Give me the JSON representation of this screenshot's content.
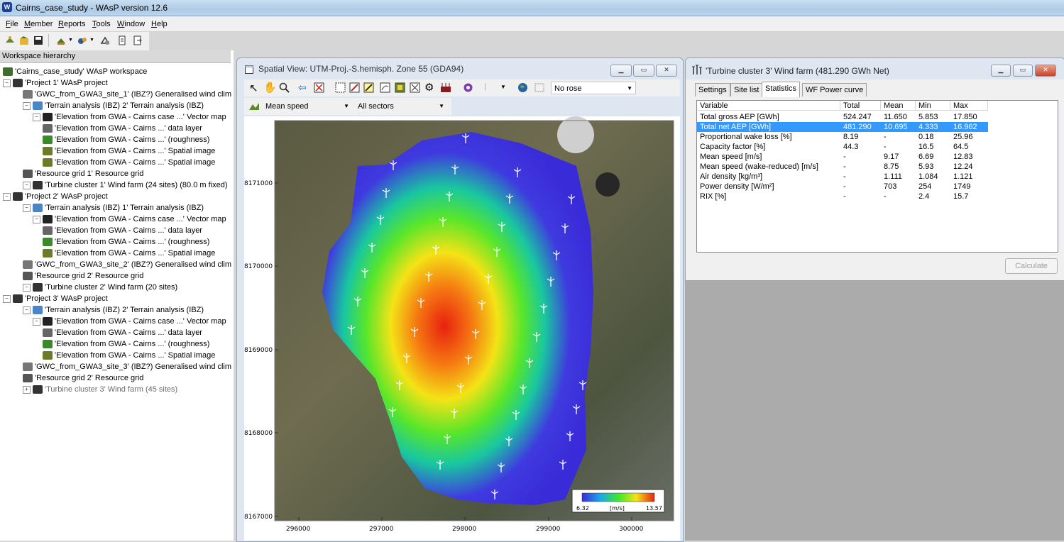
{
  "window": {
    "title": "Cairns_case_study - WAsP version 12.6",
    "app_icon": "W"
  },
  "menu": [
    "File",
    "Member",
    "Reports",
    "Tools",
    "Window",
    "Help"
  ],
  "workspace": {
    "header": "Workspace hierarchy",
    "rows": [
      {
        "label": "'Cairns_case_study' WAsP workspace",
        "icon": "workspace-icon"
      },
      {
        "label": "'Project 1' WAsP project",
        "icon": "project-icon"
      },
      {
        "label": "'GWC_from_GWA3_site_1' (IBZ?) Generalised wind clim",
        "icon": "generalised-wind-climate-icon"
      },
      {
        "label": "'Terrain analysis (IBZ) 2' Terrain analysis (IBZ)",
        "icon": "terrain-analysis-icon"
      },
      {
        "label": "'Elevation from GWA - Cairns case ...' Vector map",
        "icon": "vector-map-icon"
      },
      {
        "label": "'Elevation from GWA - Cairns ...' data layer",
        "icon": "data-layer-icon"
      },
      {
        "label": "'Elevation from GWA - Cairns ...' (roughness)",
        "icon": "roughness-layer-icon"
      },
      {
        "label": "'Elevation from GWA - Cairns ...' Spatial image",
        "icon": "spatial-image-icon"
      },
      {
        "label": "'Elevation from GWA - Cairns ...' Spatial image",
        "icon": "spatial-image-icon"
      },
      {
        "label": "'Resource grid 1' Resource grid",
        "icon": "resource-grid-icon"
      },
      {
        "label": "'Turbine cluster 1' Wind farm (24 sites) (80.0 m fixed)",
        "icon": "wind-farm-icon"
      },
      {
        "label": "'Project 2' WAsP project",
        "icon": "project-icon"
      },
      {
        "label": "'Terrain analysis (IBZ) 1' Terrain analysis (IBZ)",
        "icon": "terrain-analysis-icon"
      },
      {
        "label": "'Elevation from GWA - Cairns case ...' Vector map",
        "icon": "vector-map-icon"
      },
      {
        "label": "'Elevation from GWA - Cairns ...' data layer",
        "icon": "data-layer-icon"
      },
      {
        "label": "'Elevation from GWA - Cairns ...' (roughness)",
        "icon": "roughness-layer-icon"
      },
      {
        "label": "'Elevation from GWA - Cairns ...' Spatial image",
        "icon": "spatial-image-icon"
      },
      {
        "label": "'GWC_from_GWA3_site_2' (IBZ?) Generalised wind clim",
        "icon": "generalised-wind-climate-icon"
      },
      {
        "label": "'Resource grid 2' Resource grid",
        "icon": "resource-grid-icon"
      },
      {
        "label": "'Turbine cluster 2' Wind farm (20 sites)",
        "icon": "wind-farm-icon"
      },
      {
        "label": "'Project 3' WAsP project",
        "icon": "project-icon"
      },
      {
        "label": "'Terrain analysis (IBZ) 2' Terrain analysis (IBZ)",
        "icon": "terrain-analysis-icon"
      },
      {
        "label": "'Elevation from GWA - Cairns case ...' Vector map",
        "icon": "vector-map-icon"
      },
      {
        "label": "'Elevation from GWA - Cairns ...' data layer",
        "icon": "data-layer-icon"
      },
      {
        "label": "'Elevation from GWA - Cairns ...' (roughness)",
        "icon": "roughness-layer-icon"
      },
      {
        "label": "'Elevation from GWA - Cairns ...' Spatial image",
        "icon": "spatial-image-icon"
      },
      {
        "label": "'GWC_from_GWA3_site_3' (IBZ?) Generalised wind clim",
        "icon": "generalised-wind-climate-icon"
      },
      {
        "label": "'Resource grid 2' Resource grid",
        "icon": "resource-grid-icon"
      },
      {
        "label": "'Turbine cluster 3' Wind farm (45 sites)",
        "icon": "wind-farm-icon",
        "greyed": true
      }
    ]
  },
  "spatial_view": {
    "title": "Spatial View: UTM-Proj.-S.hemisph. Zone 55 (GDA94)",
    "rose_select": "No rose",
    "variable_select": "Mean speed",
    "sector_select": "All sectors",
    "legend": {
      "min": "6.32",
      "unit": "[m/s]",
      "max": "13.57"
    },
    "y_ticks": [
      "8171000",
      "8170000",
      "8169000",
      "8168000",
      "8167000"
    ],
    "x_ticks": [
      "296000",
      "297000",
      "298000",
      "299000",
      "300000"
    ]
  },
  "wind_farm": {
    "title": "'Turbine cluster 3' Wind farm (481.290 GWh Net)",
    "tabs": [
      "Settings",
      "Site list",
      "Statistics",
      "WF Power curve"
    ],
    "active_tab": "Statistics",
    "columns": [
      "Variable",
      "Total",
      "Mean",
      "Min",
      "Max"
    ],
    "rows": [
      {
        "variable": "Total gross AEP [GWh]",
        "total": "524.247",
        "mean": "11.650",
        "min": "5.853",
        "max": "17.850"
      },
      {
        "variable": "Total net AEP [GWh]",
        "total": "481.290",
        "mean": "10.695",
        "min": "4.333",
        "max": "16.962",
        "selected": true
      },
      {
        "variable": "Proportional wake loss [%]",
        "total": "8.19",
        "mean": "-",
        "min": "0.18",
        "max": "25.96"
      },
      {
        "variable": "Capacity factor [%]",
        "total": "44.3",
        "mean": "-",
        "min": "16.5",
        "max": "64.5"
      },
      {
        "variable": "Mean speed [m/s]",
        "total": "-",
        "mean": "9.17",
        "min": "6.69",
        "max": "12.83"
      },
      {
        "variable": "Mean speed (wake-reduced) [m/s]",
        "total": "-",
        "mean": "8.75",
        "min": "5.93",
        "max": "12.24"
      },
      {
        "variable": "Air density [kg/m³]",
        "total": "-",
        "mean": "1.111",
        "min": "1.084",
        "max": "1.121"
      },
      {
        "variable": "Power density [W/m²]",
        "total": "-",
        "mean": "703",
        "min": "254",
        "max": "1749"
      },
      {
        "variable": "RIX [%]",
        "total": "-",
        "mean": "-",
        "min": "2.4",
        "max": "15.7"
      }
    ],
    "calculate_label": "Calculate"
  },
  "colors": {
    "selection": "#3399ff",
    "map_low": "#3a2bd8",
    "map_high": "#e8210f"
  }
}
